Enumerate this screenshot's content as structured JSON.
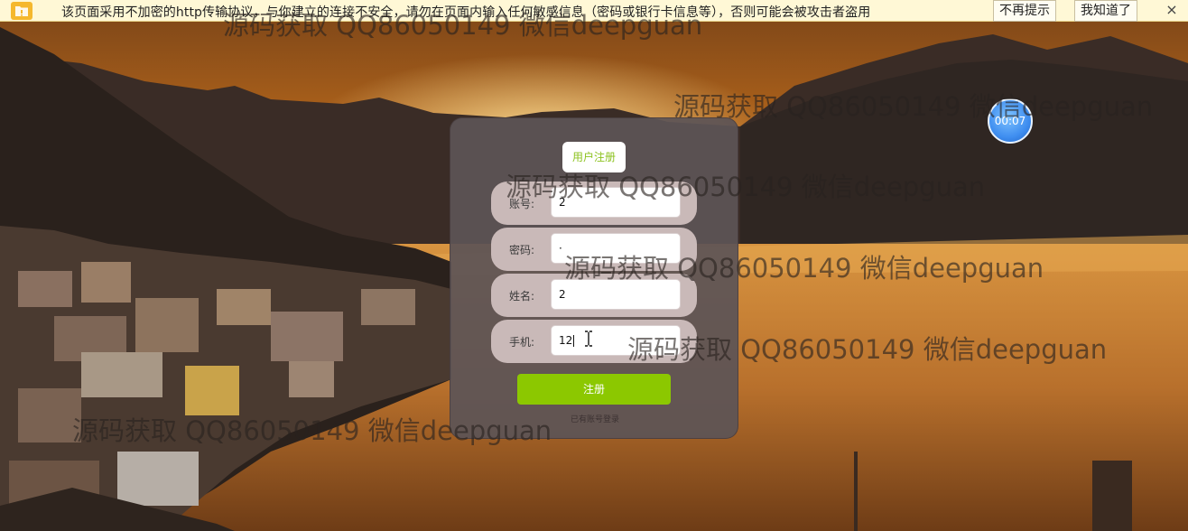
{
  "security_bar": {
    "message": "该页面采用不加密的http传输协议，与你建立的连接不安全，请勿在页面内输入任何敏感信息（密码或银行卡信息等），否则可能会被攻击者盗用",
    "no_remind_label": "不再提示",
    "got_it_label": "我知道了",
    "close_symbol": "×"
  },
  "register_form": {
    "title": "用户注册",
    "fields": [
      {
        "label": "账号:",
        "value": "2"
      },
      {
        "label": "密码:",
        "value": "·"
      },
      {
        "label": "姓名:",
        "value": "2"
      },
      {
        "label": "手机:",
        "value": "12"
      }
    ],
    "submit_label": "注册",
    "login_link": "已有账号登录"
  },
  "timer": {
    "value": "00:07"
  },
  "watermark": {
    "text": "源码获取 QQ86050149 微信deepguan"
  },
  "colors": {
    "accent_green": "#8cc800",
    "title_green": "#8cc21f",
    "warning_bar": "#fff8d6",
    "timer_blue": "#3f8ef0"
  },
  "icons": {
    "warning_icon": "folder-warning-icon",
    "close_icon": "close-icon",
    "text_cursor": "i-beam-cursor-icon"
  }
}
